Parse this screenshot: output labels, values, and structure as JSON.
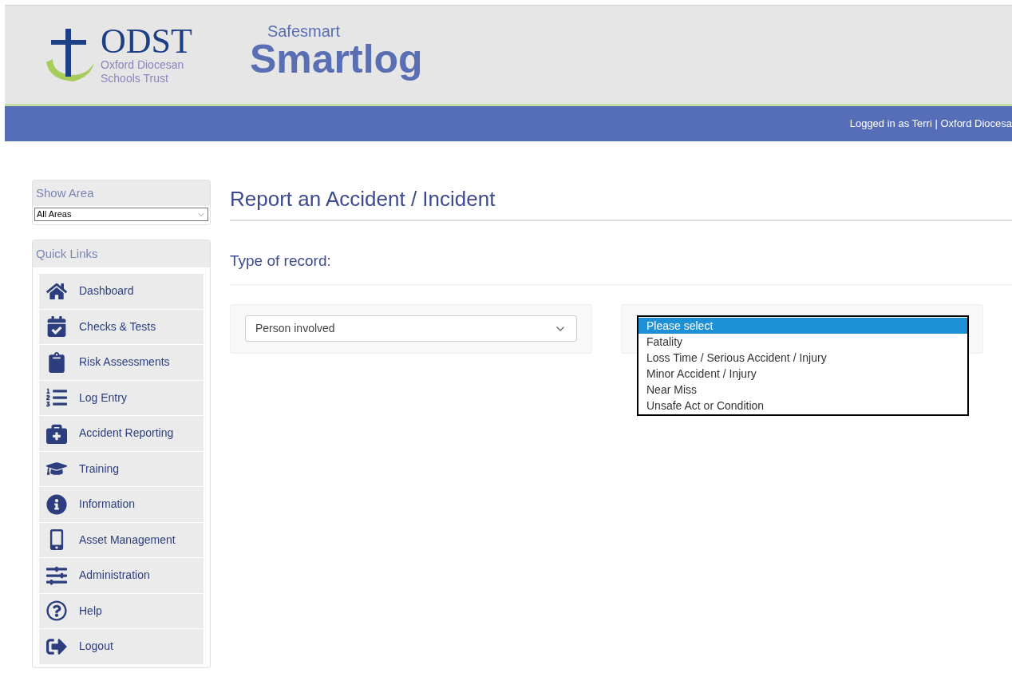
{
  "header": {
    "org_name": "ODST",
    "org_subtitle": [
      "Oxford Diocesan",
      "Schools Trust"
    ],
    "product_prefix": "Safesmart",
    "product_name": "Smartlog"
  },
  "user_bar": {
    "text": "Logged in as Terri | Oxford Diocesa"
  },
  "sidebar": {
    "show_area": {
      "title": "Show Area",
      "value": "All Areas"
    },
    "quick_links": {
      "title": "Quick Links",
      "items": [
        {
          "label": "Dashboard"
        },
        {
          "label": "Checks & Tests"
        },
        {
          "label": "Risk Assessments"
        },
        {
          "label": "Log Entry"
        },
        {
          "label": "Accident Reporting"
        },
        {
          "label": "Training"
        },
        {
          "label": "Information"
        },
        {
          "label": "Asset Management"
        },
        {
          "label": "Administration"
        },
        {
          "label": "Help"
        },
        {
          "label": "Logout"
        }
      ]
    }
  },
  "page_title": "Report an Accident / Incident",
  "section_title": "Type of record:",
  "person_select": {
    "value": "Person involved"
  },
  "record_type_list": {
    "options": [
      {
        "label": "Please select",
        "selected": true
      },
      {
        "label": "Fatality",
        "selected": false
      },
      {
        "label": "Loss Time / Serious Accident / Injury",
        "selected": false
      },
      {
        "label": "Minor Accident / Injury",
        "selected": false
      },
      {
        "label": "Near Miss",
        "selected": false
      },
      {
        "label": "Unsafe Act or Condition",
        "selected": false
      }
    ]
  }
}
